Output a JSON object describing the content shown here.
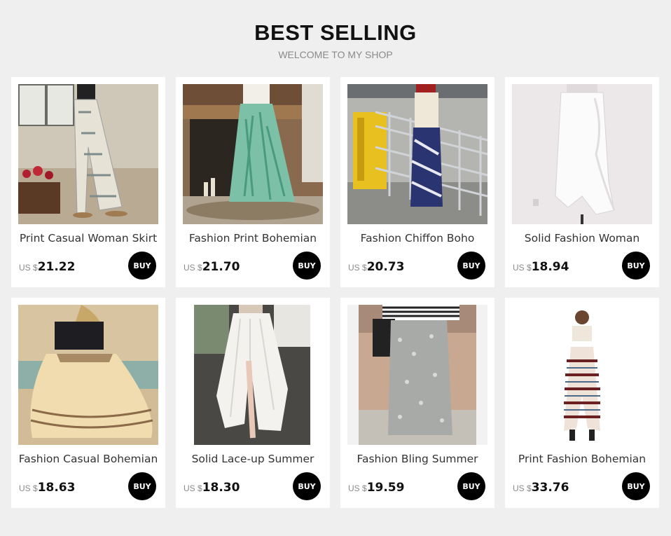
{
  "header": {
    "title": "BEST SELLING",
    "subtitle": "WELCOME TO MY SHOP"
  },
  "products": [
    {
      "name": "Print Casual Woman Skirt",
      "currency": "US $",
      "price": "21.22",
      "buy": "BUY"
    },
    {
      "name": "Fashion Print Bohemian",
      "currency": "US $",
      "price": "21.70",
      "buy": "BUY"
    },
    {
      "name": "Fashion Chiffon Boho",
      "currency": "US $",
      "price": "20.73",
      "buy": "BUY"
    },
    {
      "name": "Solid Fashion Woman",
      "currency": "US $",
      "price": "18.94",
      "buy": "BUY"
    },
    {
      "name": "Fashion Casual Bohemian",
      "currency": "US $",
      "price": "18.63",
      "buy": "BUY"
    },
    {
      "name": "Solid Lace-up Summer",
      "currency": "US $",
      "price": "18.30",
      "buy": "BUY"
    },
    {
      "name": "Fashion Bling Summer",
      "currency": "US $",
      "price": "19.59",
      "buy": "BUY"
    },
    {
      "name": "Print Fashion Bohemian",
      "currency": "US $",
      "price": "33.76",
      "buy": "BUY"
    }
  ]
}
